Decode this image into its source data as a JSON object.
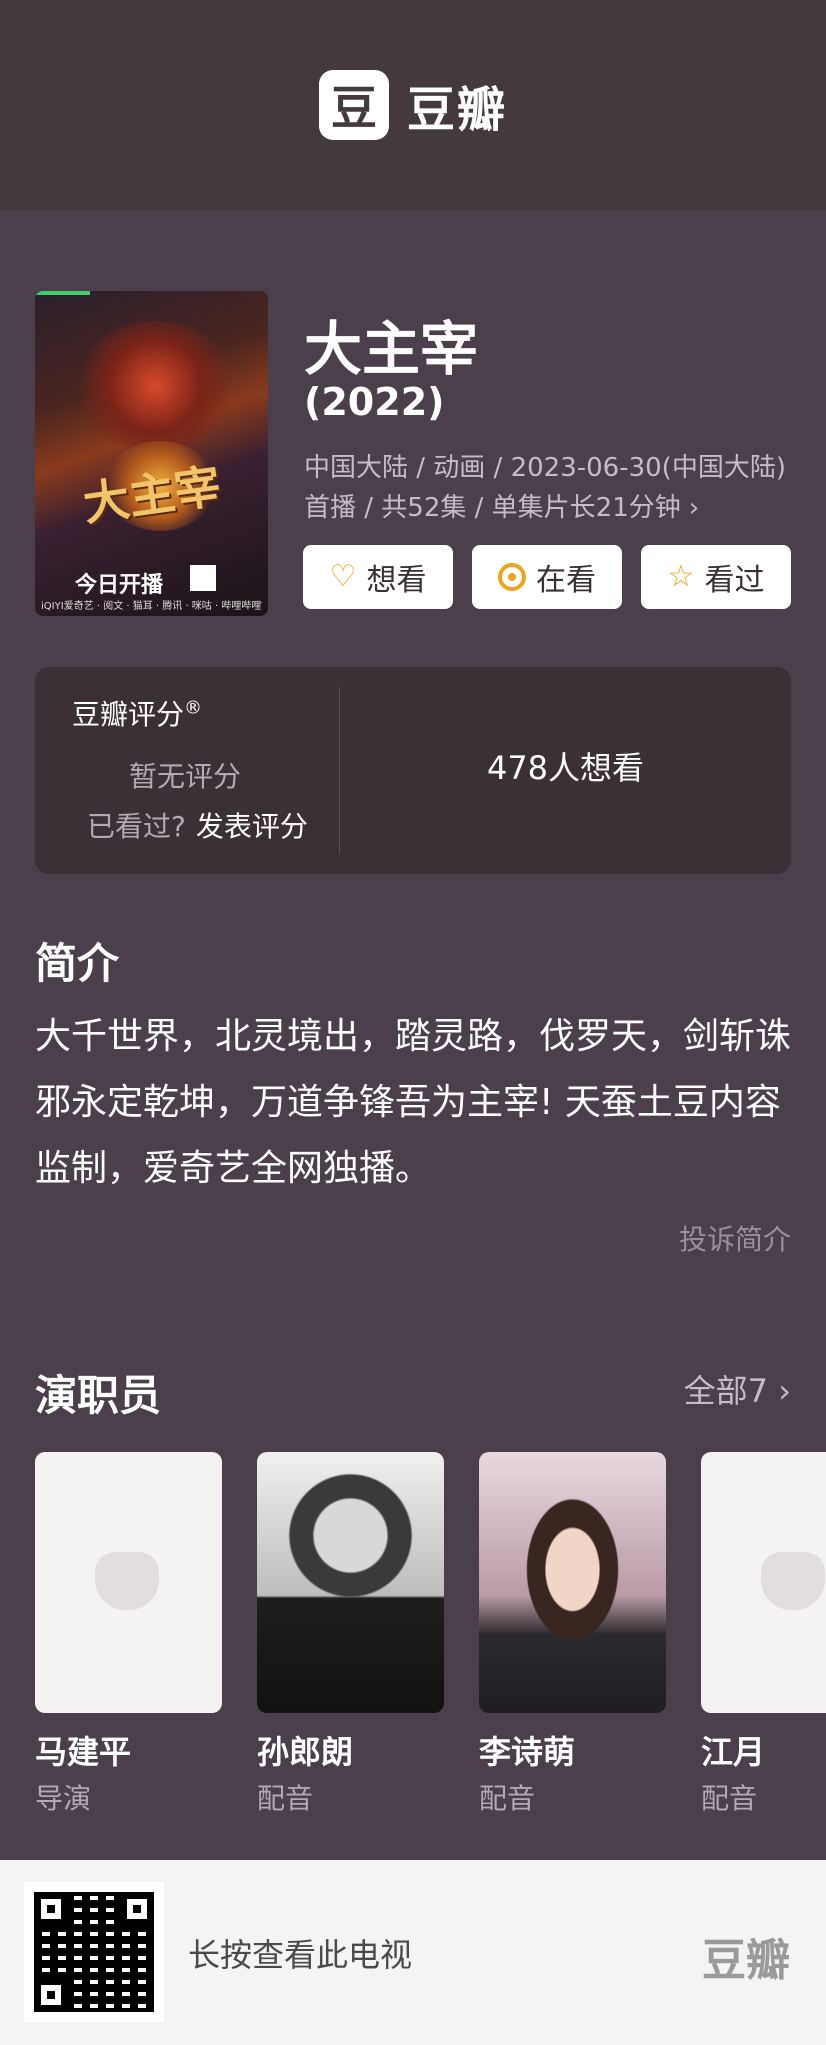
{
  "header": {
    "logo_glyph": "豆",
    "logo_text": "豆瓣"
  },
  "poster": {
    "title_art": "大主宰",
    "badge": "今日开播",
    "partners": "iQIYI爱奇艺 · 阅文 · 猫耳 · 腾讯 · 咪咕 · 哔哩哔哩TV"
  },
  "show": {
    "title": "大主宰",
    "year": "(2022)",
    "meta": "中国大陆 / 动画 / 2023-06-30(中国大陆)首播 / 共52集 / 单集片长21分钟",
    "meta_chevron": "›"
  },
  "actions": {
    "want": {
      "label": "想看",
      "icon": "heart-plus-icon"
    },
    "watching": {
      "label": "在看",
      "icon": "target-icon"
    },
    "watched": {
      "label": "看过",
      "icon": "star-icon"
    }
  },
  "rating": {
    "label": "豆瓣评分",
    "registered": "®",
    "no_rating": "暂无评分",
    "seen_prompt": "已看过?",
    "post_rating": "发表评分",
    "want_count": "478人想看"
  },
  "intro": {
    "title": "简介",
    "text": "大千世界，北灵境出，踏灵路，伐罗天，剑斩诛邪永定乾坤，万道争锋吾为主宰! 天蚕土豆内容监制，爱奇艺全网独播。",
    "report": "投诉简介"
  },
  "cast": {
    "title": "演职员",
    "all_link": "全部7",
    "all_chevron": "›",
    "members": [
      {
        "name": "马建平",
        "role": "导演"
      },
      {
        "name": "孙郎朗",
        "role": "配音"
      },
      {
        "name": "李诗萌",
        "role": "配音"
      },
      {
        "name": "江月",
        "role": "配音"
      }
    ]
  },
  "footer": {
    "prompt": "长按查看此电视",
    "logo": "豆瓣"
  }
}
